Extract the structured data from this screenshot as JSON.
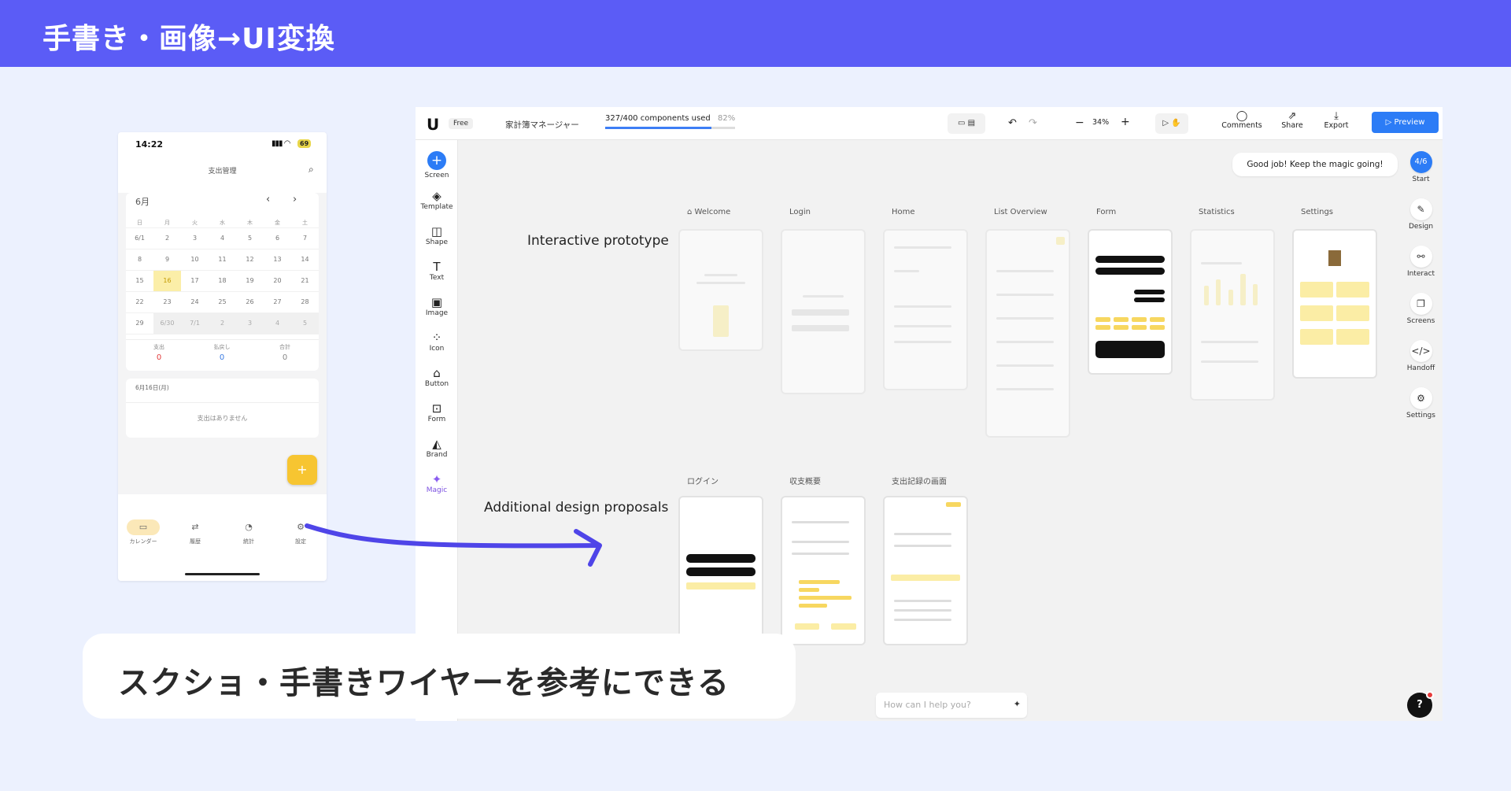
{
  "header": {
    "title": "手書き・画像→UI変換"
  },
  "callout": {
    "text": "スクショ・手書きワイヤーを参考にできる"
  },
  "phone": {
    "status": {
      "time": "14:22",
      "battery": "69"
    },
    "title": "支出管理",
    "month": "6月",
    "weekdays": [
      "日",
      "月",
      "火",
      "水",
      "木",
      "金",
      "土"
    ],
    "weeks": [
      [
        "6/1",
        "2",
        "3",
        "4",
        "5",
        "6",
        "7"
      ],
      [
        "8",
        "9",
        "10",
        "11",
        "12",
        "13",
        "14"
      ],
      [
        "15",
        "16",
        "17",
        "18",
        "19",
        "20",
        "21"
      ],
      [
        "22",
        "23",
        "24",
        "25",
        "26",
        "27",
        "28"
      ],
      [
        "29",
        "6/30",
        "7/1",
        "2",
        "3",
        "4",
        "5"
      ]
    ],
    "today": "16",
    "summary": [
      {
        "label": "支出",
        "value": "0",
        "color": "#e23b3b"
      },
      {
        "label": "払戻し",
        "value": "0",
        "color": "#3b7be2"
      },
      {
        "label": "合計",
        "value": "0",
        "color": "#333333"
      }
    ],
    "day_card": {
      "date": "6月16日(月)",
      "empty": "支出はありません"
    },
    "fab": "+",
    "tabs": [
      "カレンダー",
      "履歴",
      "統計",
      "設定"
    ]
  },
  "app": {
    "plan": "Free",
    "project": "家計簿マネージャー",
    "usage": {
      "text": "327/400 components used",
      "percent": "82%",
      "ratio": 0.82
    },
    "zoom": "34%",
    "top_actions": [
      "Comments",
      "Share",
      "Export"
    ],
    "preview": "Preview",
    "left_tools": [
      "Screen",
      "Template",
      "Shape",
      "Text",
      "Image",
      "Icon",
      "Button",
      "Form",
      "Brand",
      "Magic"
    ],
    "right_tools": [
      {
        "label": "Start",
        "badge": "4/6"
      },
      {
        "label": "Design"
      },
      {
        "label": "Interact"
      },
      {
        "label": "Screens"
      },
      {
        "label": "Handoff"
      },
      {
        "label": "Settings"
      }
    ],
    "toast": "Good job! Keep the magic going!",
    "row1_label": "Interactive prototype",
    "row2_label": "Additional design proposals",
    "row1_screens": [
      "Welcome",
      "Login",
      "Home",
      "List Overview",
      "Form",
      "Statistics",
      "Settings"
    ],
    "row2_screens": [
      "ログイン",
      "収支概要",
      "支出記録の画面"
    ],
    "ask_placeholder": "How can I help you?",
    "help": "?"
  }
}
